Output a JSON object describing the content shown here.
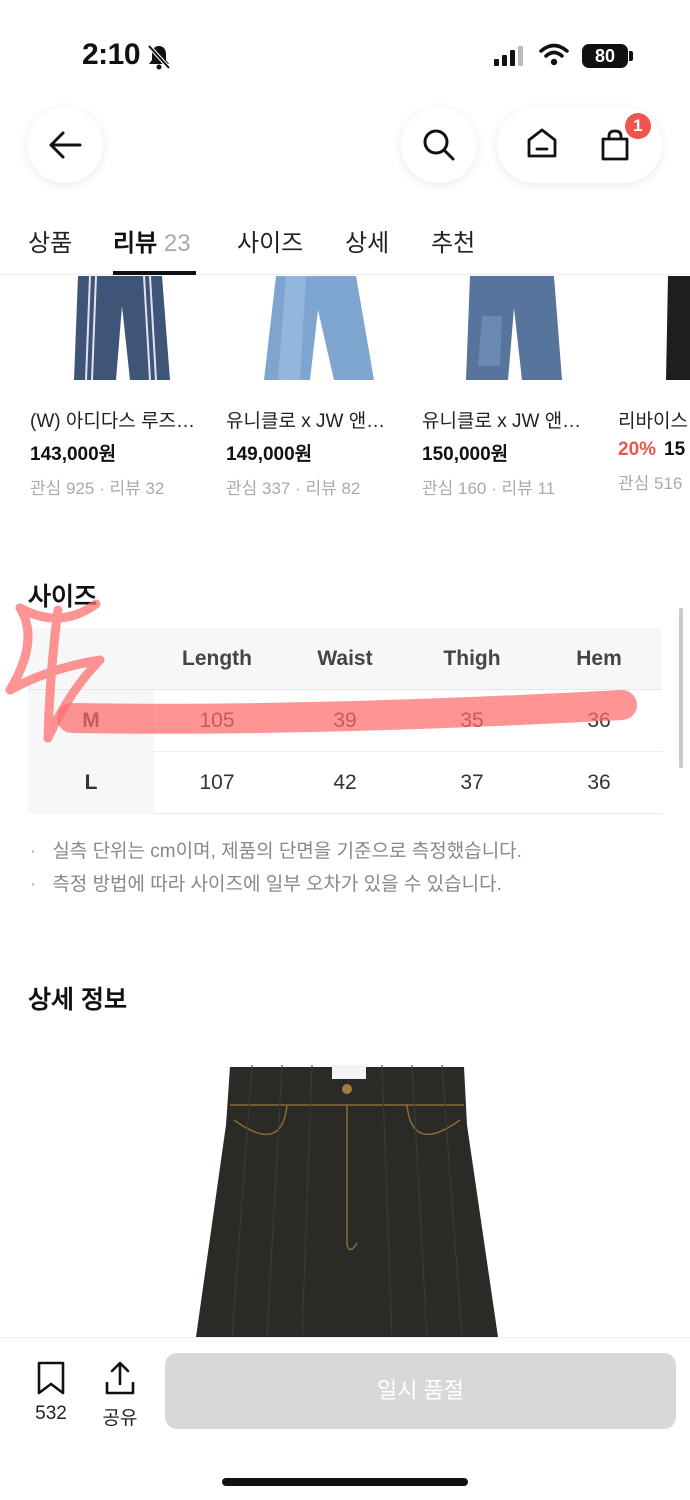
{
  "status_bar": {
    "time": "2:10",
    "battery": "80"
  },
  "nav": {
    "cart_count": "1"
  },
  "tabs": [
    {
      "label": "상품"
    },
    {
      "label": "리뷰",
      "count": "23"
    },
    {
      "label": "사이즈"
    },
    {
      "label": "상세"
    },
    {
      "label": "추천"
    }
  ],
  "active_tab": "리뷰",
  "products": [
    {
      "name": "(W) 아디다스 루즈…",
      "price": "143,000원",
      "meta": "관심 925 · 리뷰 32",
      "color": "#3f5578"
    },
    {
      "name": "유니클로 x JW 앤…",
      "price": "149,000원",
      "meta": "관심 337 · 리뷰 82",
      "color": "#7ea4d0"
    },
    {
      "name": "유니클로 x JW 앤…",
      "price": "150,000원",
      "meta": "관심 160 · 리뷰 11",
      "color": "#56749c"
    },
    {
      "name": "리바이스…",
      "discount": "20%",
      "price": "15",
      "meta": "관심 516",
      "color": "#1e1e1e"
    }
  ],
  "size_section": {
    "title": "사이즈",
    "columns": [
      "Length",
      "Waist",
      "Thigh",
      "Hem"
    ],
    "rows": [
      {
        "size": "M",
        "values": [
          "105",
          "39",
          "35",
          "36"
        ]
      },
      {
        "size": "L",
        "values": [
          "107",
          "42",
          "37",
          "36"
        ]
      }
    ],
    "notes": [
      "실측 단위는 cm이며, 제품의 단면을 기준으로 측정했습니다.",
      "측정 방법에 따라 사이즈에 일부 오차가 있을 수 있습니다."
    ]
  },
  "detail_section": {
    "title": "상세 정보"
  },
  "bottom_bar": {
    "bookmark_count": "532",
    "share_label": "공유",
    "buy_label": "일시 품절"
  },
  "colors": {
    "accent_red": "#f0544f",
    "annotation_pink": "#ff6b6b",
    "disabled_button": "#d8d8d8"
  }
}
